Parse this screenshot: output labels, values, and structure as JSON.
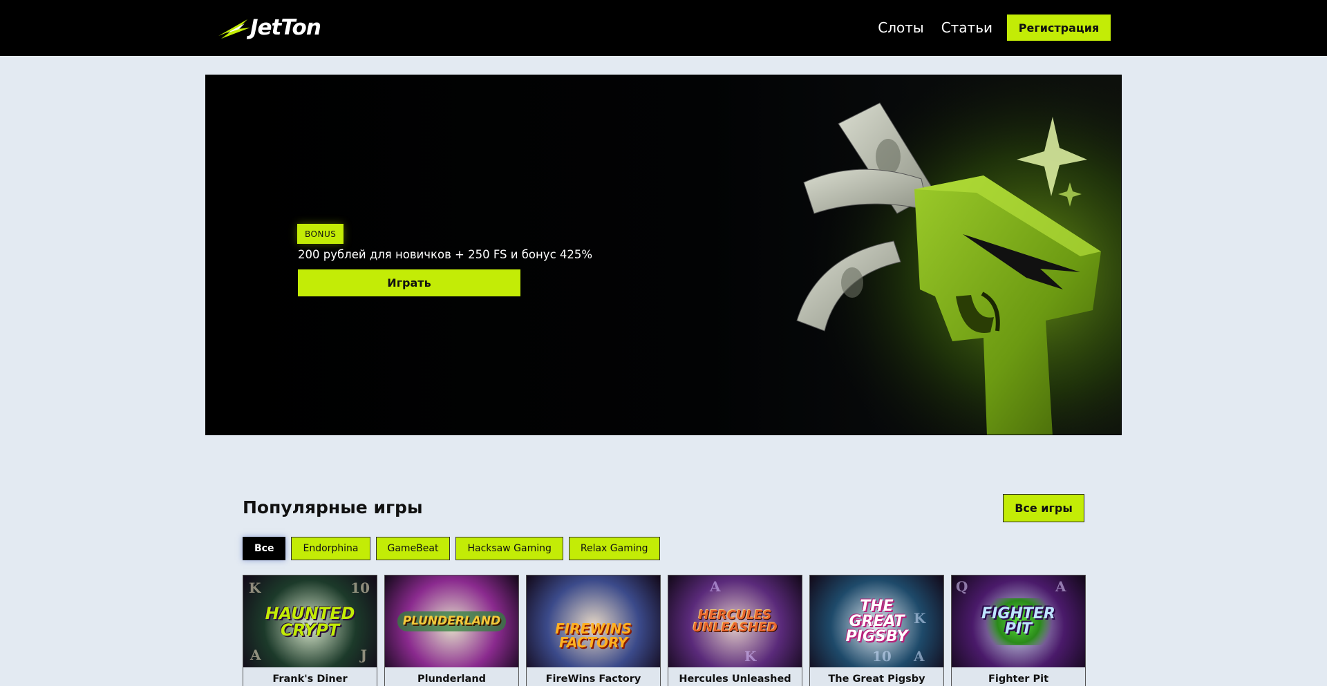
{
  "header": {
    "logo_text": "JetTon",
    "nav": [
      {
        "label": "Слоты"
      },
      {
        "label": "Статьи"
      }
    ],
    "register_label": "Регистрация"
  },
  "hero": {
    "badge": "BONUS",
    "text": "200 рублей для новичков + 250 FS и бонус 425%",
    "play_label": "Играть"
  },
  "popular": {
    "title": "Популярные игры",
    "all_games_label": "Все игры",
    "filters": [
      {
        "label": "Все",
        "active": true
      },
      {
        "label": "Endorphina",
        "active": false
      },
      {
        "label": "GameBeat",
        "active": false
      },
      {
        "label": "Hacksaw Gaming",
        "active": false
      },
      {
        "label": "Relax Gaming",
        "active": false
      }
    ],
    "games": [
      {
        "name": "Frank's Diner",
        "thumb_text": "HAUNTED CRYPT",
        "bg": "#1c3a2a",
        "accent": "#b6e03a"
      },
      {
        "name": "Plunderland",
        "thumb_text": "PLUNDERLAND",
        "bg": "#8a2a8e",
        "accent": "#f5c93a"
      },
      {
        "name": "FireWins Factory",
        "thumb_text": "FIREWINS FACTORY",
        "bg": "#3b4a8a",
        "accent": "#ff9a1f"
      },
      {
        "name": "Hercules Unleashed",
        "thumb_text": "HERCULES UNLEASHED",
        "bg": "#5a2a7a",
        "accent": "#e0552a"
      },
      {
        "name": "The Great Pigsby",
        "thumb_text": "THE GREAT PIGSBY",
        "bg": "#1e4a6a",
        "accent": "#ffffff"
      },
      {
        "name": "Fighter Pit",
        "thumb_text": "FIGHTER PIT",
        "bg": "#4a1a6a",
        "accent": "#9ad8ff"
      }
    ]
  },
  "colors": {
    "accent": "#c3ec06",
    "header_bg": "#000000",
    "page_bg": "#e3eaf2"
  }
}
